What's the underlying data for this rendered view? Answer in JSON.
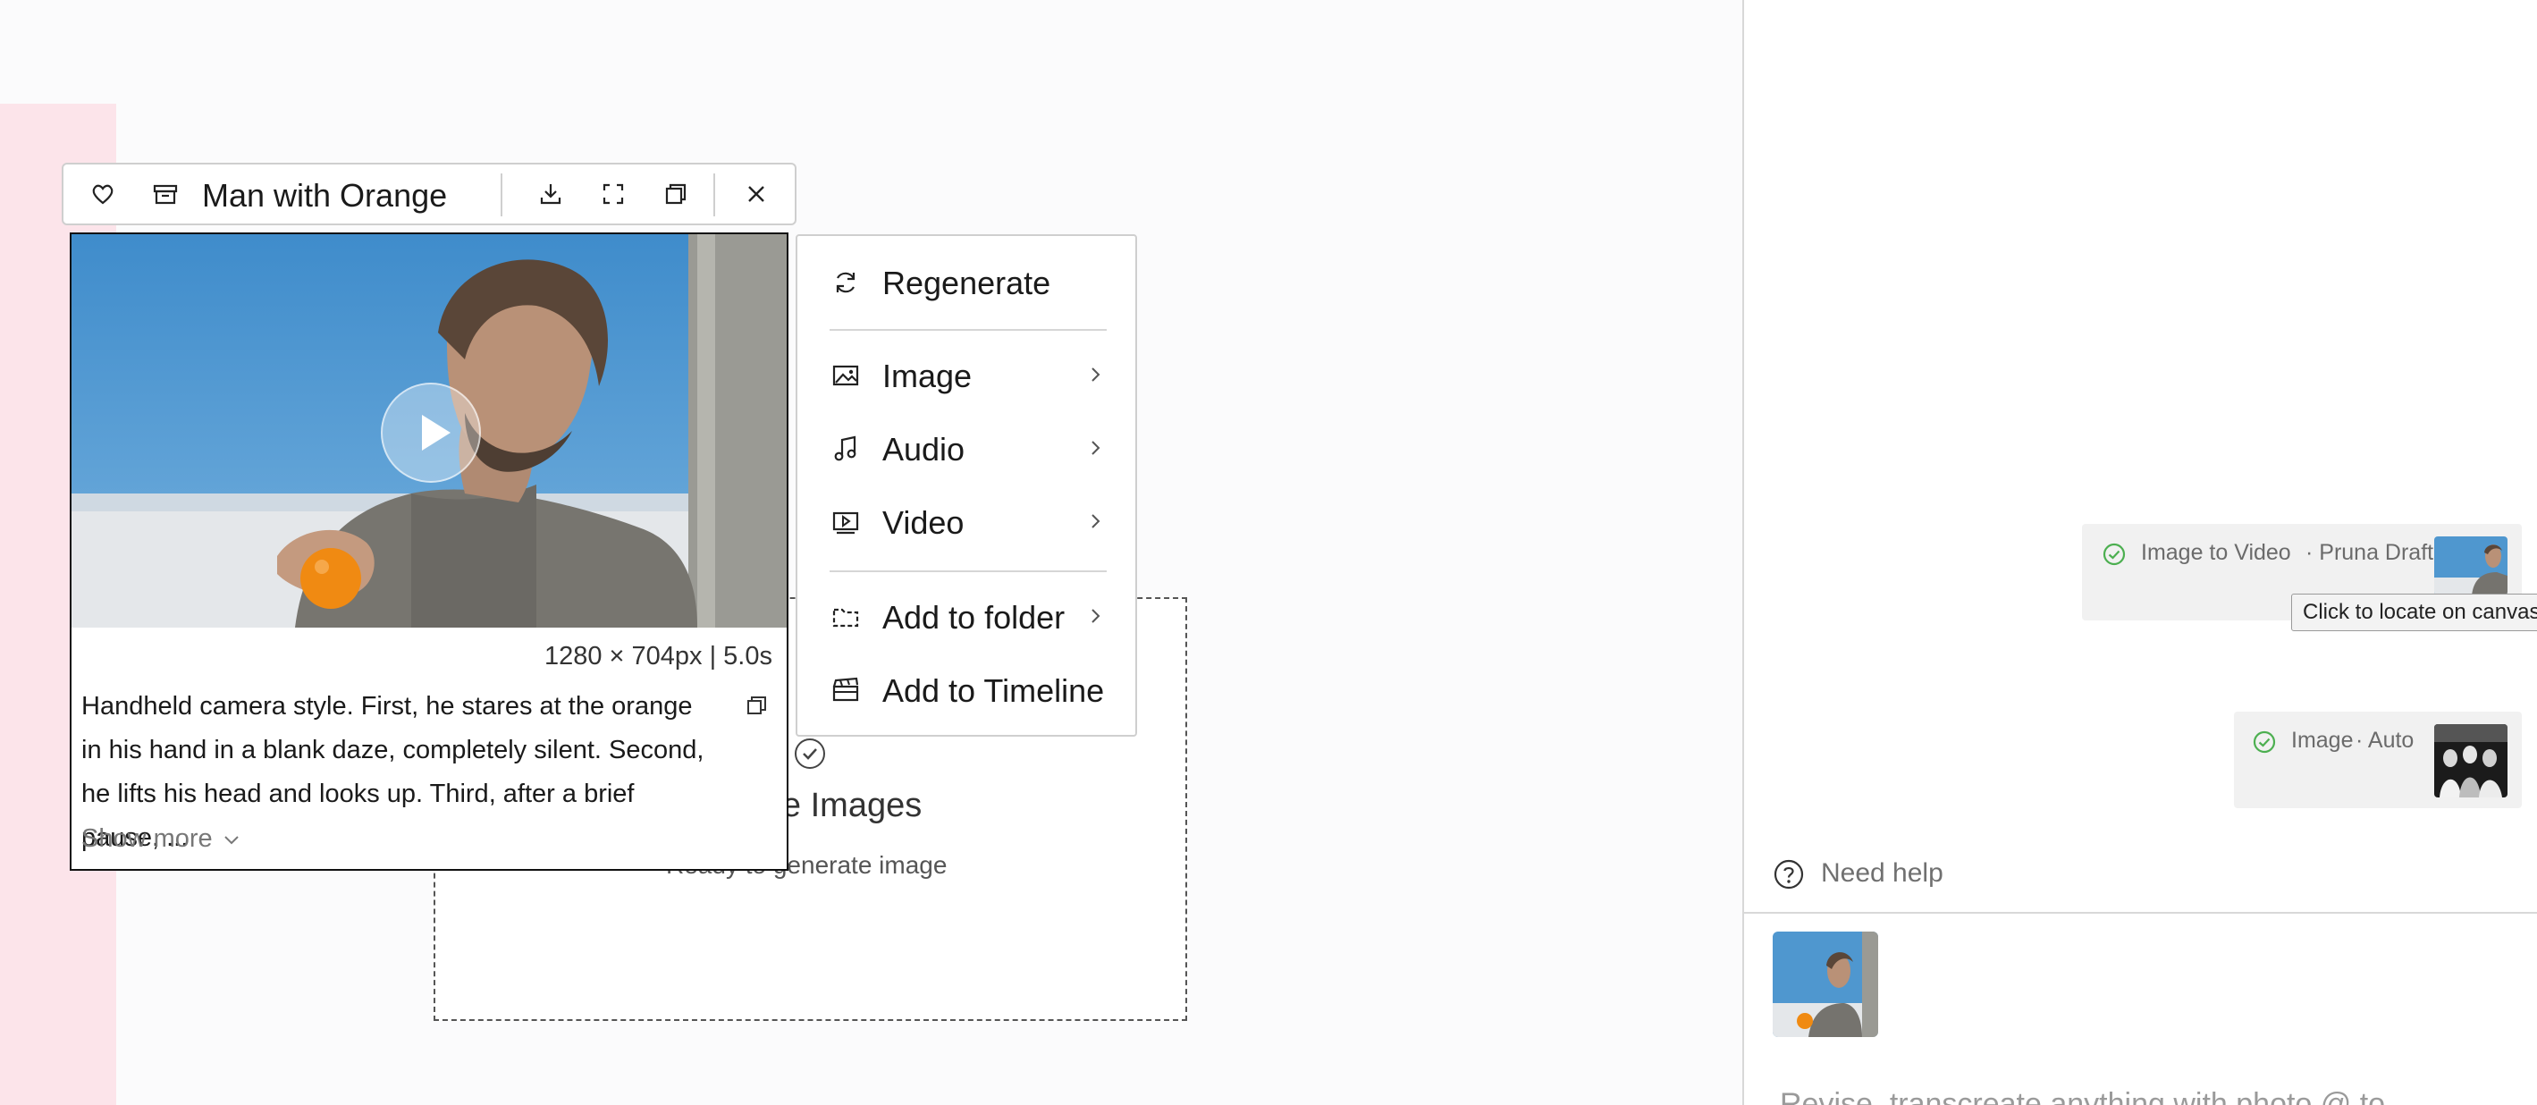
{
  "canvas": {
    "merge_node": {
      "title": "erge Images",
      "subtitle": "Ready to generate image"
    }
  },
  "toolbar": {
    "title": "Man with Orange",
    "icons": [
      "heart-icon",
      "archive-icon",
      "download-icon",
      "fullscreen-icon",
      "copy-icon",
      "close-icon"
    ]
  },
  "preview": {
    "dimensions": "1280 × 704px | 5.0s",
    "description": "Handheld camera style. First, he stares at the orange in his hand in a blank daze, completely silent. Second, he lifts his head and looks up. Third, after a brief pause, ...",
    "show_more": "Show more"
  },
  "context_menu": {
    "items": [
      {
        "label": "Regenerate",
        "icon": "refresh-icon"
      },
      {
        "label": "Image",
        "icon": "image-icon"
      },
      {
        "label": "Audio",
        "icon": "music-note-icon"
      },
      {
        "label": "Video",
        "icon": "video-icon"
      },
      {
        "label": "Add to folder",
        "icon": "folder-select-icon"
      },
      {
        "label": "Add to Timeline",
        "icon": "clapperboard-icon"
      }
    ]
  },
  "right_panel": {
    "tasks": [
      {
        "type": "Image to Video",
        "model": "· Pruna Draft"
      },
      {
        "type": "Image",
        "model": "· Auto"
      }
    ],
    "tooltip": "Click to locate on canvas",
    "help": "Need help",
    "input_placeholder": "Revise, transcreate anything with photo @ to"
  },
  "colors": {
    "success": "#4caf50",
    "pink_strip": "#fce4ea",
    "sky": "#4f97cf"
  }
}
